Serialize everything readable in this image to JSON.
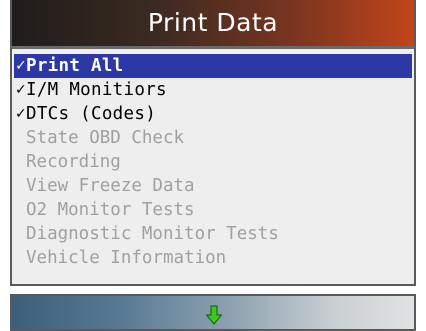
{
  "screen": {
    "title": "Print Data"
  },
  "menu": {
    "check_glyph": "✓",
    "items": [
      {
        "label": "Print All",
        "checked": true,
        "enabled": true,
        "selected": true
      },
      {
        "label": "I/M Monitiors",
        "checked": true,
        "enabled": true,
        "selected": false
      },
      {
        "label": "DTCs (Codes)",
        "checked": true,
        "enabled": true,
        "selected": false
      },
      {
        "label": "State OBD Check",
        "checked": false,
        "enabled": false,
        "selected": false
      },
      {
        "label": "Recording",
        "checked": false,
        "enabled": false,
        "selected": false
      },
      {
        "label": "View Freeze Data",
        "checked": false,
        "enabled": false,
        "selected": false
      },
      {
        "label": "O2 Monitor Tests",
        "checked": false,
        "enabled": false,
        "selected": false
      },
      {
        "label": "Diagnostic Monitor Tests",
        "checked": false,
        "enabled": false,
        "selected": false
      },
      {
        "label": "Vehicle Information",
        "checked": false,
        "enabled": false,
        "selected": false
      }
    ]
  },
  "footer": {
    "scroll_icon": "down-arrow-icon",
    "scroll_icon_color": "#3ec81e"
  },
  "colors": {
    "selection": "#2b38a6",
    "disabled_text": "#a0a0a0",
    "panel": "#eeeeee"
  }
}
